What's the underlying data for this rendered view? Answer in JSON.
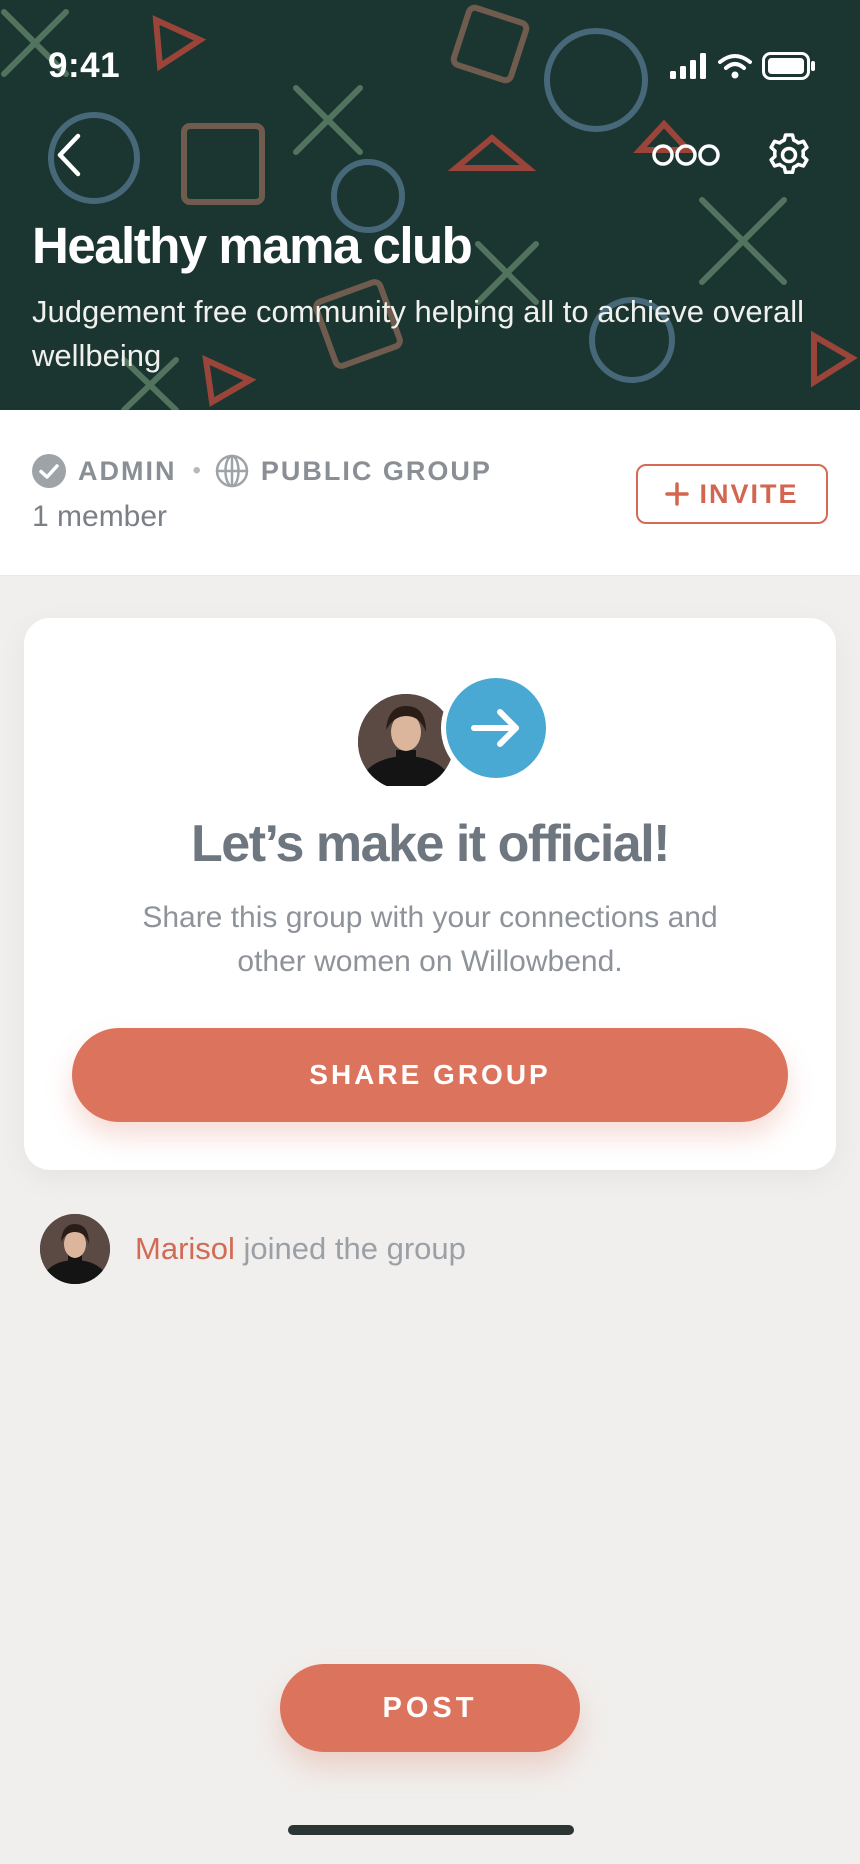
{
  "status_bar": {
    "time": "9:41"
  },
  "header": {
    "title": "Healthy mama club",
    "subtitle": "Judgement free community helping all to achieve overall wellbeing"
  },
  "meta": {
    "role": "ADMIN",
    "visibility": "PUBLIC GROUP",
    "members": "1 member",
    "invite_label": "INVITE"
  },
  "promo_card": {
    "title": "Let’s make it official!",
    "text": "Share this group with your connections and other women on Willowbend.",
    "button_label": "SHARE GROUP"
  },
  "activity": {
    "name": "Marisol",
    "text": " joined the group"
  },
  "post_label": "POST",
  "colors": {
    "header_bg": "#1b3530",
    "accent": "#dc735d",
    "background": "#f1efed",
    "arrow_bubble": "#4aa9d3"
  }
}
